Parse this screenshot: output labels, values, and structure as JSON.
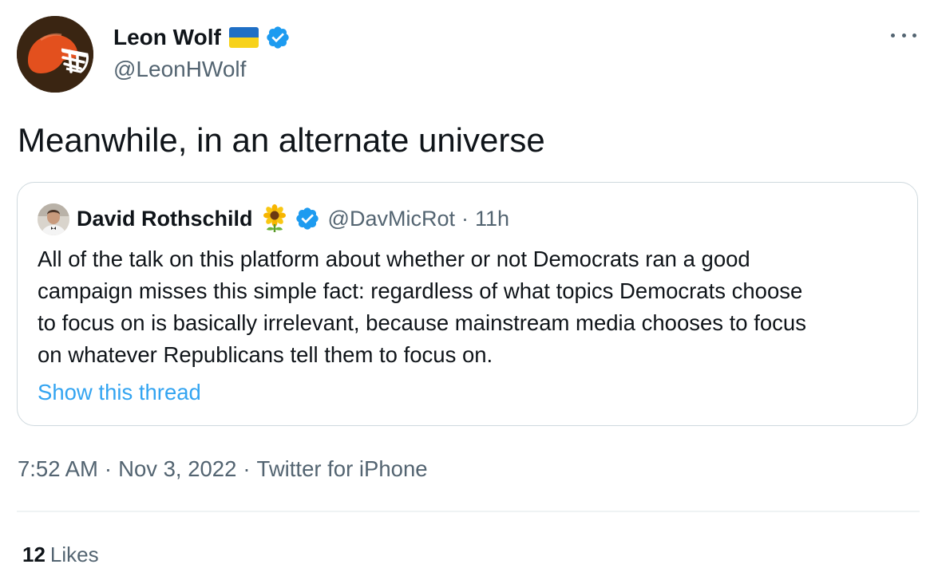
{
  "author": {
    "display_name": "Leon Wolf",
    "handle": "@LeonHWolf",
    "avatar_icon": "football-helmet-icon",
    "flag_icon": "ukraine-flag-icon",
    "verified_icon": "verified-badge-icon"
  },
  "tweet": {
    "text": "Meanwhile, in an alternate universe",
    "time": "7:52 AM",
    "date": "Nov 3, 2022",
    "source": "Twitter for iPhone",
    "separator": "·"
  },
  "quoted_tweet": {
    "display_name": "David Rothschild",
    "emoji_icon": "sunflower-icon",
    "verified_icon": "verified-badge-icon",
    "handle": "@DavMicRot",
    "separator": "·",
    "time": "11h",
    "lines": [
      "All of the talk on this platform about whether or not Democrats ran a good",
      "campaign misses this simple fact: regardless of what topics Democrats choose",
      "to focus on is basically irrelevant, because mainstream media chooses to focus",
      "on whatever Republicans tell them to focus on."
    ],
    "show_thread": "Show this thread"
  },
  "stats": {
    "likes_count": "12",
    "likes_label": "Likes"
  },
  "colors": {
    "accent": "#1d9bf0",
    "secondary_text": "#536471",
    "primary_text": "#0f1419",
    "border": "#cfd9de",
    "helmet_orange": "#e3501e",
    "avatar_bg": "#3a2512"
  }
}
